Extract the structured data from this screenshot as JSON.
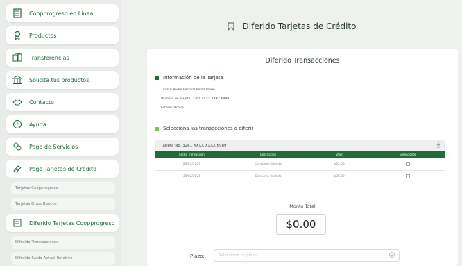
{
  "sidebar": {
    "items": [
      {
        "label": "Coopprogreso en Línea",
        "icon": "building-icon"
      },
      {
        "label": "Productos",
        "icon": "award-icon"
      },
      {
        "label": "Transferencias",
        "icon": "transfer-icon"
      },
      {
        "label": "Solicita tus productos",
        "icon": "bank-icon"
      },
      {
        "label": "Contacto",
        "icon": "handshake-icon"
      },
      {
        "label": "Ayuda",
        "icon": "help-icon"
      },
      {
        "label": "Pago de Servicios",
        "icon": "services-icon"
      },
      {
        "label": "Pago Tarjetas de Crédito",
        "icon": "card-pay-icon"
      }
    ],
    "sub_items_1": [
      "Tarjetas Coopprogreso",
      "Tarjetas Otros Bancos"
    ],
    "diferido": {
      "label": "Diferido Tarjetas Coopprogreso",
      "icon": "card-icon"
    },
    "sub_items_2": [
      "Diferido Transacciones",
      "Diferido Saldo Actual Rotativo"
    ]
  },
  "page": {
    "title": "Diferido Tarjetas de Crédito"
  },
  "card": {
    "title": "Diferido Transacciones",
    "info_heading": "Información de la Tarjeta",
    "info_lines": [
      "Titular: Pedro Pascual Pérez Prado",
      "Número de Tarjeta: 3261 XXXX XXXX 6989",
      "Estado: Activa"
    ],
    "select_heading": "Selecciona las transacciones a diferir",
    "table_caption": "Tarjeta No. 3261 XXXX XXXX 6989",
    "columns": [
      "Fecha Transacción",
      "Descripción",
      "Valor",
      "Seleccionar"
    ],
    "rows": [
      {
        "fecha": "23/01/2021",
        "descripcion": "Consumo Comida",
        "valor": "$33.00"
      },
      {
        "fecha": "30/02/2021",
        "descripcion": "Consumo Vestido",
        "valor": "$25.00"
      }
    ],
    "total_label": "Monto Total",
    "total_value": "$0.00",
    "plazo_label": "Plazo:",
    "plazo_placeholder": "Seleccione un plazo"
  },
  "colors": {
    "accent": "#1f6b3a",
    "heading_square": "#1f6b3a",
    "select_square": "#7fc241"
  }
}
